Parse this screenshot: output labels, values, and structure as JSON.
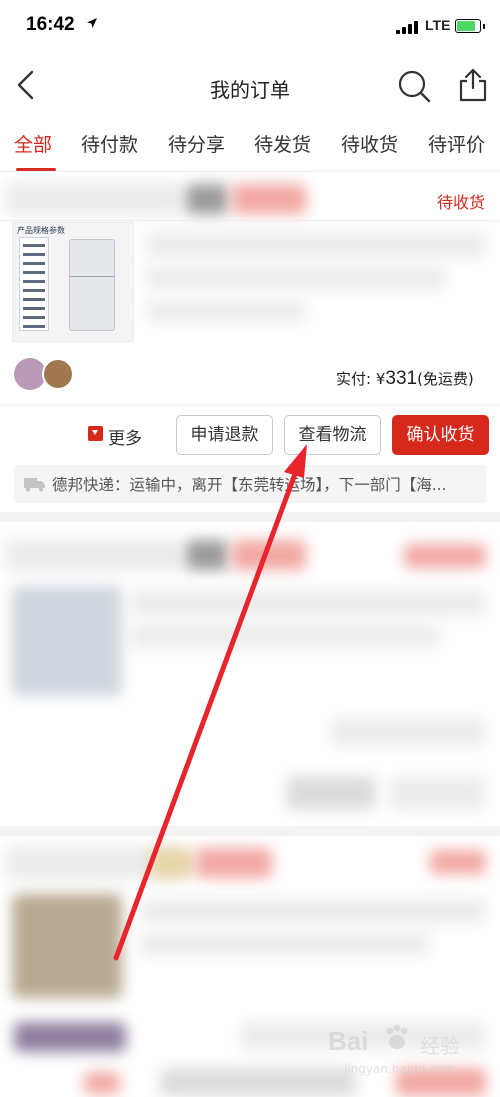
{
  "status_bar": {
    "time": "16:42",
    "carrier": "LTE"
  },
  "nav": {
    "title": "我的订单"
  },
  "tabs": [
    {
      "label": "全部",
      "active": true
    },
    {
      "label": "待付款"
    },
    {
      "label": "待分享"
    },
    {
      "label": "待发货"
    },
    {
      "label": "待收货"
    },
    {
      "label": "待评价"
    }
  ],
  "order": {
    "status": "待收货",
    "product_caption": "产品规格参数",
    "paid_label": "实付: ¥",
    "amount": "331",
    "shipping_note": "(免运费)",
    "more_label": "更多",
    "buttons": {
      "refund": "申请退款",
      "logistics": "查看物流",
      "confirm": "确认收货"
    },
    "logistics_text": "德邦快递：运输中，离开【东莞转运场】，下一部门【海..."
  },
  "watermark": {
    "brand": "Bai",
    "suffix": "经验",
    "url": "jingyan.baidu.com"
  },
  "colors": {
    "accent": "#d7281c",
    "arrow": "#e8242c"
  }
}
